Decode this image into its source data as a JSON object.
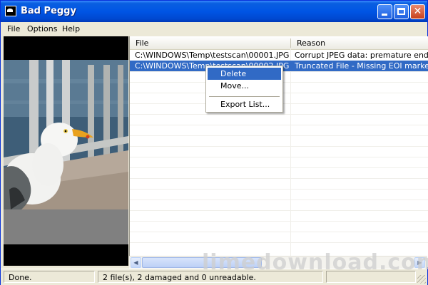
{
  "window": {
    "title": "Bad Peggy",
    "buttons": [
      "minimize",
      "maximize",
      "close"
    ],
    "close_glyph": "✕"
  },
  "menu": {
    "items": [
      {
        "label": "File"
      },
      {
        "label": "Options"
      },
      {
        "label": "Help"
      }
    ]
  },
  "preview": {
    "subject": "seagull photo preview",
    "icon": "image-preview"
  },
  "list": {
    "columns": [
      {
        "label": "File"
      },
      {
        "label": "Reason"
      }
    ],
    "rows": [
      {
        "file": "C:\\WINDOWS\\Temp\\testscan\\00001.JPG",
        "reason": "Corrupt JPEG data: premature end of data segment",
        "selected": false
      },
      {
        "file": "C:\\WINDOWS\\Temp\\testscan\\00002.JPG",
        "reason": "Truncated File - Missing EOI marker",
        "selected": true
      }
    ]
  },
  "context_menu": {
    "items": [
      {
        "label": "Delete",
        "highlighted": true
      },
      {
        "label": "Move..."
      },
      {
        "label": "Export List..."
      }
    ]
  },
  "status": {
    "left": "Done.",
    "middle": "2 file(s), 2 damaged and 0 unreadable.",
    "progress": ""
  },
  "watermark": "limedownload.com",
  "colors": {
    "titlebar": "#0055E5",
    "selection": "#316AC5",
    "chrome": "#ECE9D8"
  }
}
